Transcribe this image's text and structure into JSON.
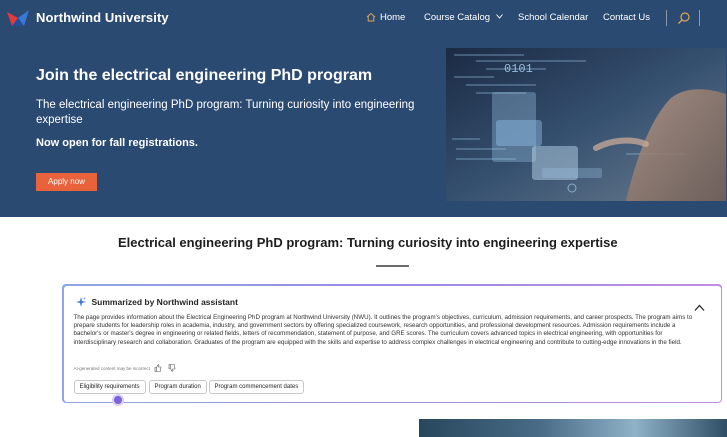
{
  "brand": {
    "name": "Northwind University"
  },
  "nav": {
    "home": "Home",
    "catalog": "Course Catalog",
    "calendar": "School Calendar",
    "contact": "Contact Us"
  },
  "hero": {
    "title": "Join the electrical engineering PhD program",
    "subtitle": "The electrical engineering PhD program: Turning curiosity into engineering expertise",
    "open_text": "Now open for fall registrations.",
    "apply_label": "Apply now",
    "image_text": "0101"
  },
  "main": {
    "title": "Electrical engineering PhD program: Turning curiosity into engineering expertise"
  },
  "summary": {
    "heading": "Summarized by Northwind assistant",
    "body": "The page provides information about the Electrical Engineering PhD program at Northwind University (NWU). It outlines the program's objectives, curriculum, admission requirements, and career prospects. The program aims to prepare students for leadership roles in academia, industry, and government sectors by offering specialized coursework, research opportunities, and professional development resources. Admission requirements include a bachelor's or master's degree in engineering or related fields, letters of recommendation, statement of purpose, and GRE scores. The curriculum covers advanced topics in electrical engineering, with opportunities for interdisciplinary research and collaboration. Graduates of the program are equipped with the skills and expertise to address complex challenges in electrical engineering and contribute to cutting-edge innovations in the field.",
    "ai_note": "AI-generated content may be incorrect",
    "chips": [
      "Eligibility requirements",
      "Program duration",
      "Program commencement dates"
    ]
  },
  "colors": {
    "hero_bg": "#2b4a72",
    "apply_button": "#e8633b",
    "summary_border_start": "#8fa6e6",
    "summary_border_end": "#c08de6",
    "home_icon": "#e0a552"
  },
  "icons": {
    "logo": "northwind-bird-logo",
    "home": "home-icon",
    "dropdown": "chevron-down-icon",
    "search": "search-icon",
    "sparkle": "sparkle-icon",
    "collapse": "chevron-up-icon",
    "thumb_up": "thumb-up-icon",
    "thumb_down": "thumb-down-icon"
  }
}
